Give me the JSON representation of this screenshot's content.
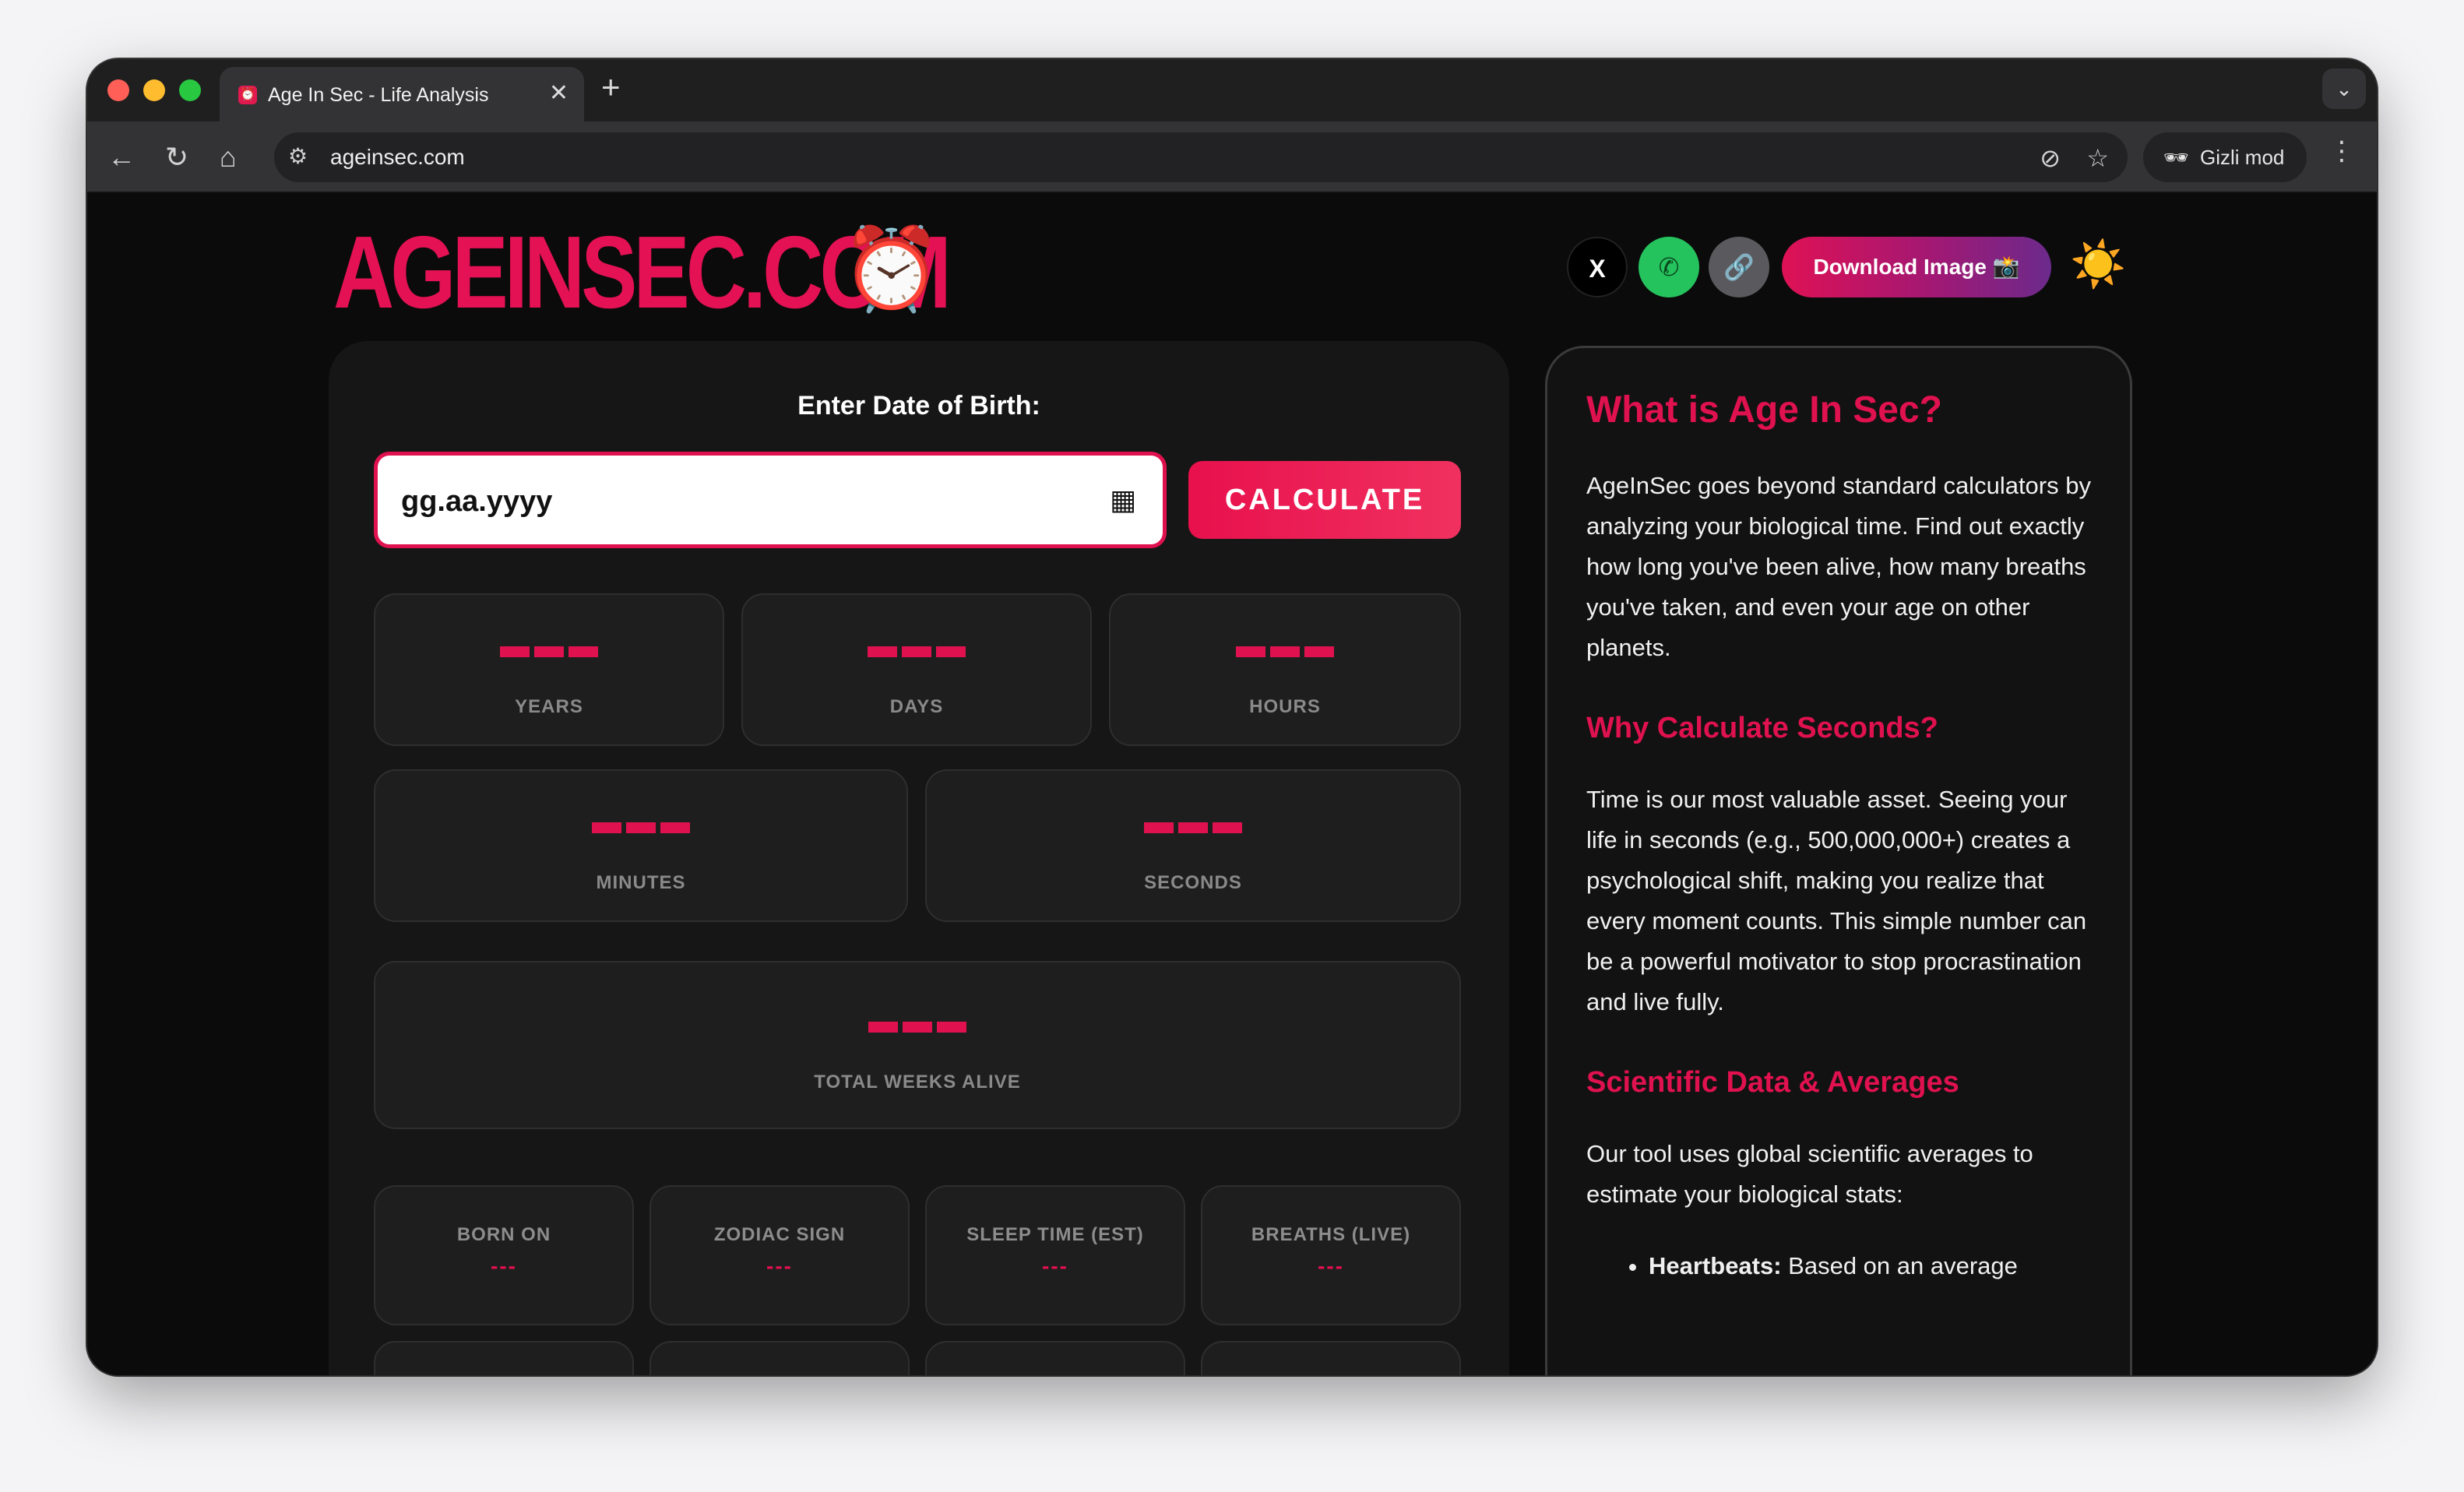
{
  "browser": {
    "tab_title": "Age In Sec - Life Analysis",
    "tab_close": "✕",
    "new_tab": "+",
    "url": "ageinsec.com",
    "incognito_label": "Gizli mod"
  },
  "header": {
    "logo_text": "AGEINSEC.COM",
    "logo_emoji": "⏰",
    "social": [
      {
        "name": "x-share",
        "label": "X"
      },
      {
        "name": "phone-share",
        "label": "✆"
      },
      {
        "name": "link-copy",
        "label": "🔗"
      }
    ],
    "download_label": "Download Image 📸",
    "theme_icon": "☀️"
  },
  "calculator": {
    "dob_label": "Enter Date of Birth:",
    "date_placeholder": "gg.aa.yyyy",
    "calculate_label": "CALCULATE",
    "stats": [
      {
        "label": "YEARS"
      },
      {
        "label": "DAYS"
      },
      {
        "label": "HOURS"
      },
      {
        "label": "MINUTES"
      },
      {
        "label": "SECONDS"
      },
      {
        "label": "TOTAL WEEKS ALIVE"
      }
    ],
    "mini_stats": [
      {
        "label": "BORN ON",
        "value": "---"
      },
      {
        "label": "ZODIAC SIGN",
        "value": "---"
      },
      {
        "label": "SLEEP TIME (EST)",
        "value": "---"
      },
      {
        "label": "BREATHS (LIVE)",
        "value": "---"
      }
    ]
  },
  "info": {
    "title": "What is Age In Sec?",
    "intro": "AgeInSec goes beyond standard calculators by analyzing your biological time. Find out exactly how long you've been alive, how many breaths you've taken, and even your age on other planets.",
    "why_title": "Why Calculate Seconds?",
    "why_text": "Time is our most valuable asset. Seeing your life in seconds (e.g., 500,000,000+) creates a psychological shift, making you realize that every moment counts. This simple number can be a powerful motivator to stop procrastination and live fully.",
    "science_title": "Scientific Data & Averages",
    "science_text": "Our tool uses global scientific averages to estimate your biological stats:",
    "list": [
      {
        "term": "Heartbeats:",
        "text": " Based on an average"
      }
    ]
  },
  "colors": {
    "accent": "#e0114f",
    "background": "#0b0b0b",
    "card": "#1e1e1e"
  }
}
